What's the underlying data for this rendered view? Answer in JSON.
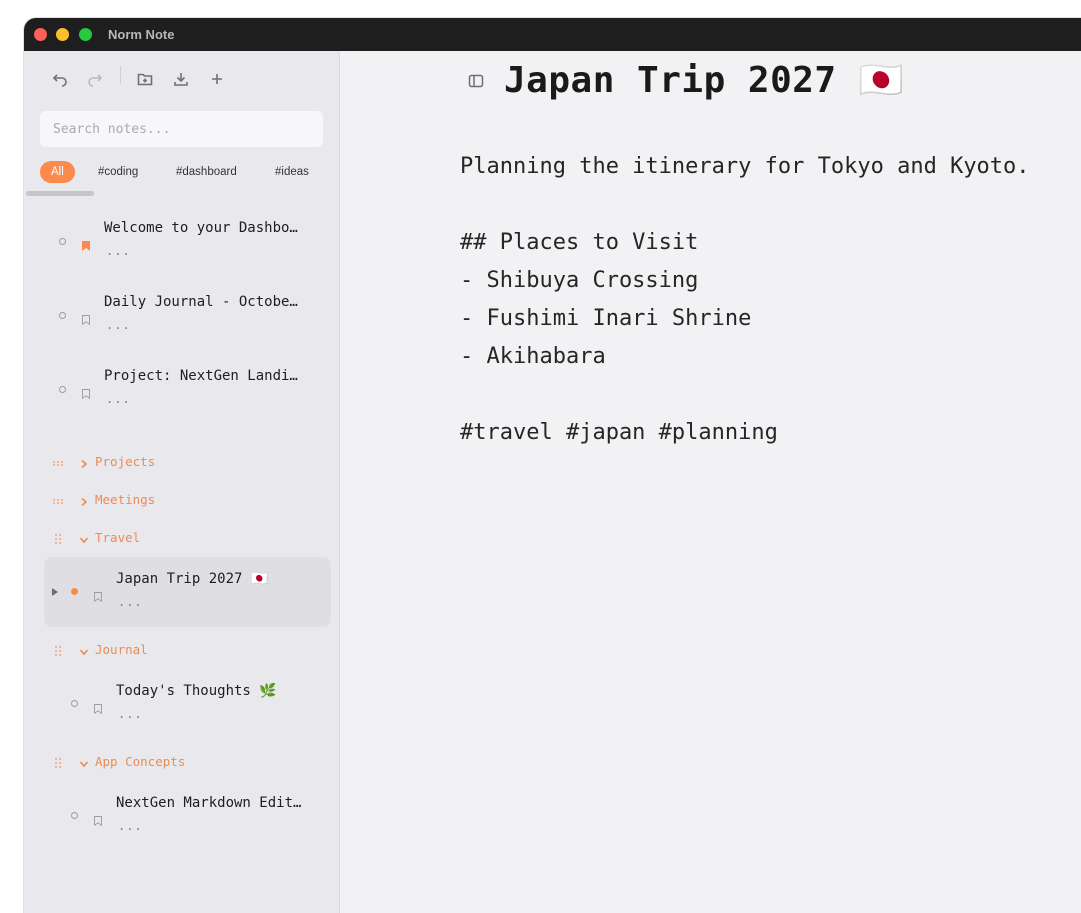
{
  "window": {
    "title": "Norm Note"
  },
  "toolbar": {
    "undo_icon": "undo-icon",
    "redo_icon": "redo-icon",
    "new_folder_icon": "folder-plus-icon",
    "download_icon": "download-icon",
    "add_icon": "plus-icon"
  },
  "search": {
    "placeholder": "Search notes..."
  },
  "tags": [
    "All",
    "#coding",
    "#dashboard",
    "#ideas"
  ],
  "notes_top": [
    {
      "title": "Welcome to your Dashbo…",
      "preview": "...",
      "bookmarked": true
    },
    {
      "title": "Daily Journal - Octobe…",
      "preview": "...",
      "bookmarked": false
    },
    {
      "title": "Project: NextGen Landi…",
      "preview": "...",
      "bookmarked": false
    }
  ],
  "folders": {
    "projects": "Projects",
    "meetings": "Meetings",
    "travel": "Travel",
    "journal": "Journal",
    "app_concepts": "App Concepts"
  },
  "folder_notes": {
    "travel": {
      "title": "Japan Trip 2027 🇯🇵",
      "preview": "..."
    },
    "journal": {
      "title": "Today's Thoughts 🌿",
      "preview": "..."
    },
    "app_concepts": {
      "title": "NextGen Markdown Edit…",
      "preview": "..."
    }
  },
  "editor": {
    "title": "Japan Trip 2027 🇯🇵",
    "body": "Planning the itinerary for Tokyo and Kyoto.\n\n## Places to Visit\n- Shibuya Crossing\n- Fushimi Inari Shrine\n- Akihabara\n\n#travel #japan #planning"
  },
  "colors": {
    "accent": "#fb8a4c",
    "sidebar_bg": "#e9e9ed",
    "editor_bg": "#f2f2f4",
    "titlebar": "#1e1e1e"
  }
}
